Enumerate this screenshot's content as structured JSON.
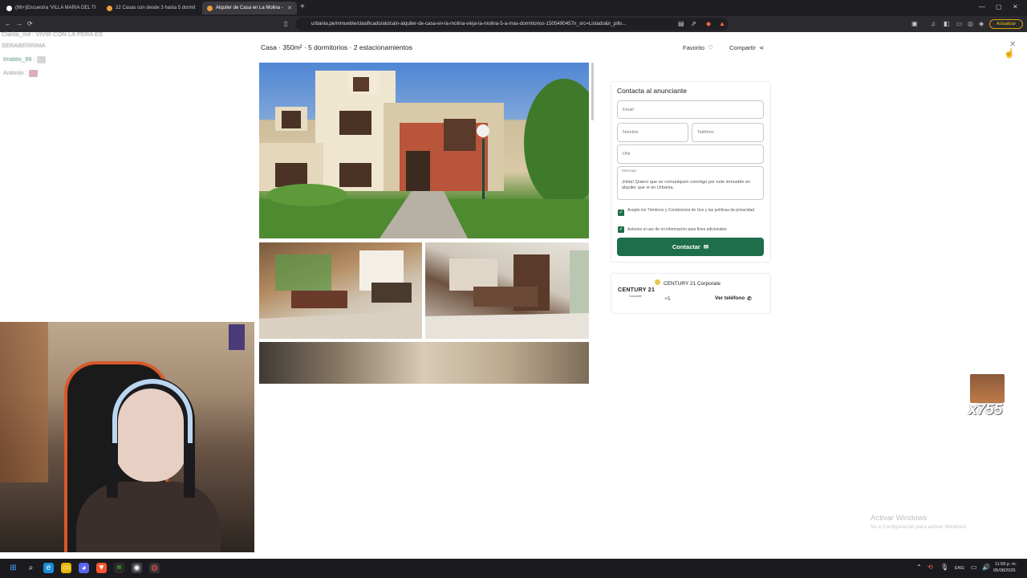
{
  "browser": {
    "tabs": [
      {
        "label": "(96+)Encuestra 'VILLA MARIA DEL TI",
        "favicon_color": "#ffffff"
      },
      {
        "label": "22 Casas con desde 3 hasta 5 dormit",
        "favicon_color": "#f29f3a"
      },
      {
        "label": "Alquiler de Casa en La Molina - ",
        "favicon_color": "#f29f3a"
      }
    ],
    "new_tab_icon": "+",
    "url": "urbania.pe/inmueble/clasificado/alclcain-alquiler-de-casa-en-la-molina-vieja-la-molina-5-a-mas-dormitorios-1505490457n_src=Listado&n_pills...",
    "update_label": "Actualizar"
  },
  "listing": {
    "header": "Casa · 350m² · 5 dormitorios · 2 estacionamientos",
    "favorite_label": "Favorito",
    "share_label": "Compartir"
  },
  "contact": {
    "title": "Contacta al anunciante",
    "email_placeholder": "Email",
    "name_placeholder": "Nombre",
    "phone_placeholder": "Teléfono",
    "dni_placeholder": "DNI",
    "message_label": "Mensaje",
    "message_text": "¡Hola! Quiero que se comuniquen conmigo por este inmueble en alquiler que vi en Urbania.",
    "terms_text": "Acepto los Términos y Condiciones de Uso y las políticas de privacidad",
    "data_text": "Autorizo el uso de mi información para fines adicionales",
    "button_label": "Contactar"
  },
  "agent": {
    "logo": "CENTURY 21",
    "logo_sub": "Corporate",
    "name": "CENTURY 21 Corporate",
    "plus": "+5",
    "view_phone": "Ver teléfono"
  },
  "stream": {
    "chat": [
      "Clarita_m4 : VIVIR CON LA PERA ES",
      "SERABERRIMA",
      "tmateo_99 :",
      "Antonio :"
    ],
    "meme_count": "x755",
    "watermark_title": "Activar Windows",
    "watermark_sub": "Ve a Configuración para activar Windows."
  },
  "taskbar": {
    "lang": "ENG",
    "time": "11:59 p. m.",
    "date": "05/08/2026"
  },
  "colors": {
    "accent_green": "#1e6e4c",
    "update_yellow": "#f2c400"
  }
}
